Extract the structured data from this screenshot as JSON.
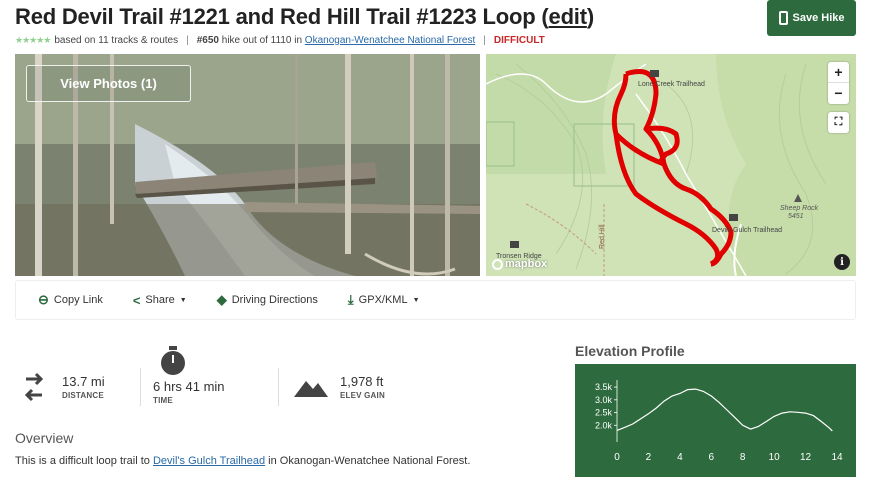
{
  "header": {
    "title": "Red Devil Trail #1221 and Red Hill Trail #1223 Loop",
    "edit_link": "edit",
    "paren_open": "(",
    "paren_close": ")",
    "save_label": "Save Hike"
  },
  "meta": {
    "stars": "★★★★★",
    "tracks_text": "based on 11 tracks & routes",
    "rank": "#650",
    "rank_text": "hike out of 1110 in",
    "forest_link": "Okanogan-Wenatchee National Forest",
    "difficulty": "DIFFICULT",
    "separator": "|"
  },
  "photo": {
    "view_photos_label": "View Photos (1)"
  },
  "map": {
    "zoom_in": "+",
    "zoom_out": "−",
    "fullscreen": "⛶",
    "logo": "mapbox",
    "info": "i",
    "labels": {
      "trailhead_top": "Lone Creek Trailhead",
      "trailhead_bottom": "Devils Gulch Trailhead",
      "sheep_rock": "Sheep Rock",
      "sheep_rock_elev": "5451",
      "tronsen": "Tronsen Ridge",
      "road": "Red Hill"
    }
  },
  "actions": [
    {
      "label": "Copy Link",
      "icon": "link-icon"
    },
    {
      "label": "Share",
      "icon": "share-icon"
    },
    {
      "label": "Driving Directions",
      "icon": "directions-icon"
    },
    {
      "label": "GPX/KML",
      "icon": "download-icon"
    }
  ],
  "stats": {
    "distance_value": "13.7 mi",
    "distance_label": "DISTANCE",
    "time_value": "6 hrs 41 min",
    "time_label": "TIME",
    "gain_value": "1,978 ft",
    "gain_label": "ELEV GAIN"
  },
  "overview": {
    "heading": "Overview",
    "text_before": "This is a difficult loop trail to ",
    "link": "Devil's Gulch Trailhead",
    "text_after": " in Okanogan-Wenatchee National Forest."
  },
  "elevation": {
    "heading": "Elevation Profile"
  },
  "colors": {
    "brand_green": "#2d6a3e",
    "difficult_red": "#c62828",
    "route_red": "#e00000",
    "link_blue": "#2a6aa8"
  },
  "chart_data": {
    "type": "line",
    "title": "Elevation Profile",
    "xlabel": "",
    "ylabel": "",
    "xlim": [
      0,
      14
    ],
    "ylim": [
      1500,
      3700
    ],
    "x_ticks": [
      "0",
      "2",
      "4",
      "6",
      "8",
      "10",
      "12",
      "14"
    ],
    "y_ticks": [
      "2.0k",
      "2.5k",
      "3.0k",
      "3.5k"
    ],
    "x": [
      0,
      0.5,
      1,
      1.5,
      2,
      2.5,
      3,
      3.5,
      4,
      4.5,
      5,
      5.5,
      6,
      6.5,
      7,
      7.5,
      8,
      8.5,
      9,
      9.5,
      10,
      10.5,
      11,
      11.5,
      12,
      12.5,
      13,
      13.5,
      13.7
    ],
    "values": [
      1800,
      1920,
      2050,
      2250,
      2450,
      2680,
      2950,
      3150,
      3250,
      3400,
      3420,
      3330,
      3150,
      2900,
      2600,
      2300,
      2000,
      1850,
      1950,
      2150,
      2350,
      2480,
      2530,
      2510,
      2480,
      2380,
      2150,
      1900,
      1780
    ]
  }
}
